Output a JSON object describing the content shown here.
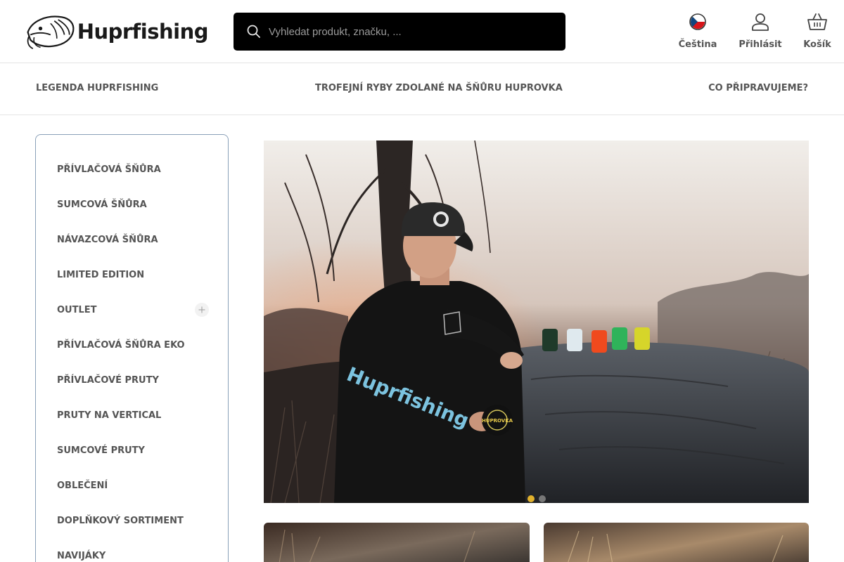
{
  "header": {
    "logo_text": "Huprfishing",
    "search": {
      "placeholder": "Vyhledat produkt, značku, ..."
    },
    "actions": {
      "language": "Čeština",
      "login": "Přihlásit",
      "cart": "Košík"
    }
  },
  "nav": {
    "items": [
      {
        "label": "LEGENDA HUPRFISHING"
      },
      {
        "label": "TROFEJNÍ RYBY ZDOLANÉ NA ŠŇŮRU HUPROVKA"
      },
      {
        "label": "CO PŘIPRAVUJEME?"
      }
    ]
  },
  "sidebar": {
    "items": [
      {
        "label": "PŘÍVLAČOVÁ ŠŇŮRA"
      },
      {
        "label": "SUMCOVÁ ŠŇŮRA"
      },
      {
        "label": "NÁVAZCOVÁ ŠŇŮRA"
      },
      {
        "label": "LIMITED EDITION"
      },
      {
        "label": "OUTLET",
        "expandable": true
      },
      {
        "label": "PŘÍVLAČOVÁ ŠŇŮRA EKO"
      },
      {
        "label": "PŘÍVLAČOVÉ PRUTY"
      },
      {
        "label": "PRUTY NA VERTICAL"
      },
      {
        "label": "SUMCOVÉ PRUTY"
      },
      {
        "label": "OBLEČENÍ"
      },
      {
        "label": "DOPLŇKOVÝ SORTIMENT"
      },
      {
        "label": "NAVIJÁKY"
      }
    ]
  },
  "hero": {
    "photo_print_text": "Huprfishing",
    "spool_label": "HUPROVKA",
    "slides_total": 2,
    "active_slide": 1
  },
  "colors": {
    "search_bg": "#000000",
    "active_dot": "#e1b12c",
    "sidebar_border": "#8aa0b8",
    "text": "#555555"
  },
  "icons": [
    "search-icon",
    "czech-flag-icon",
    "user-icon",
    "basket-icon",
    "plus-icon"
  ]
}
